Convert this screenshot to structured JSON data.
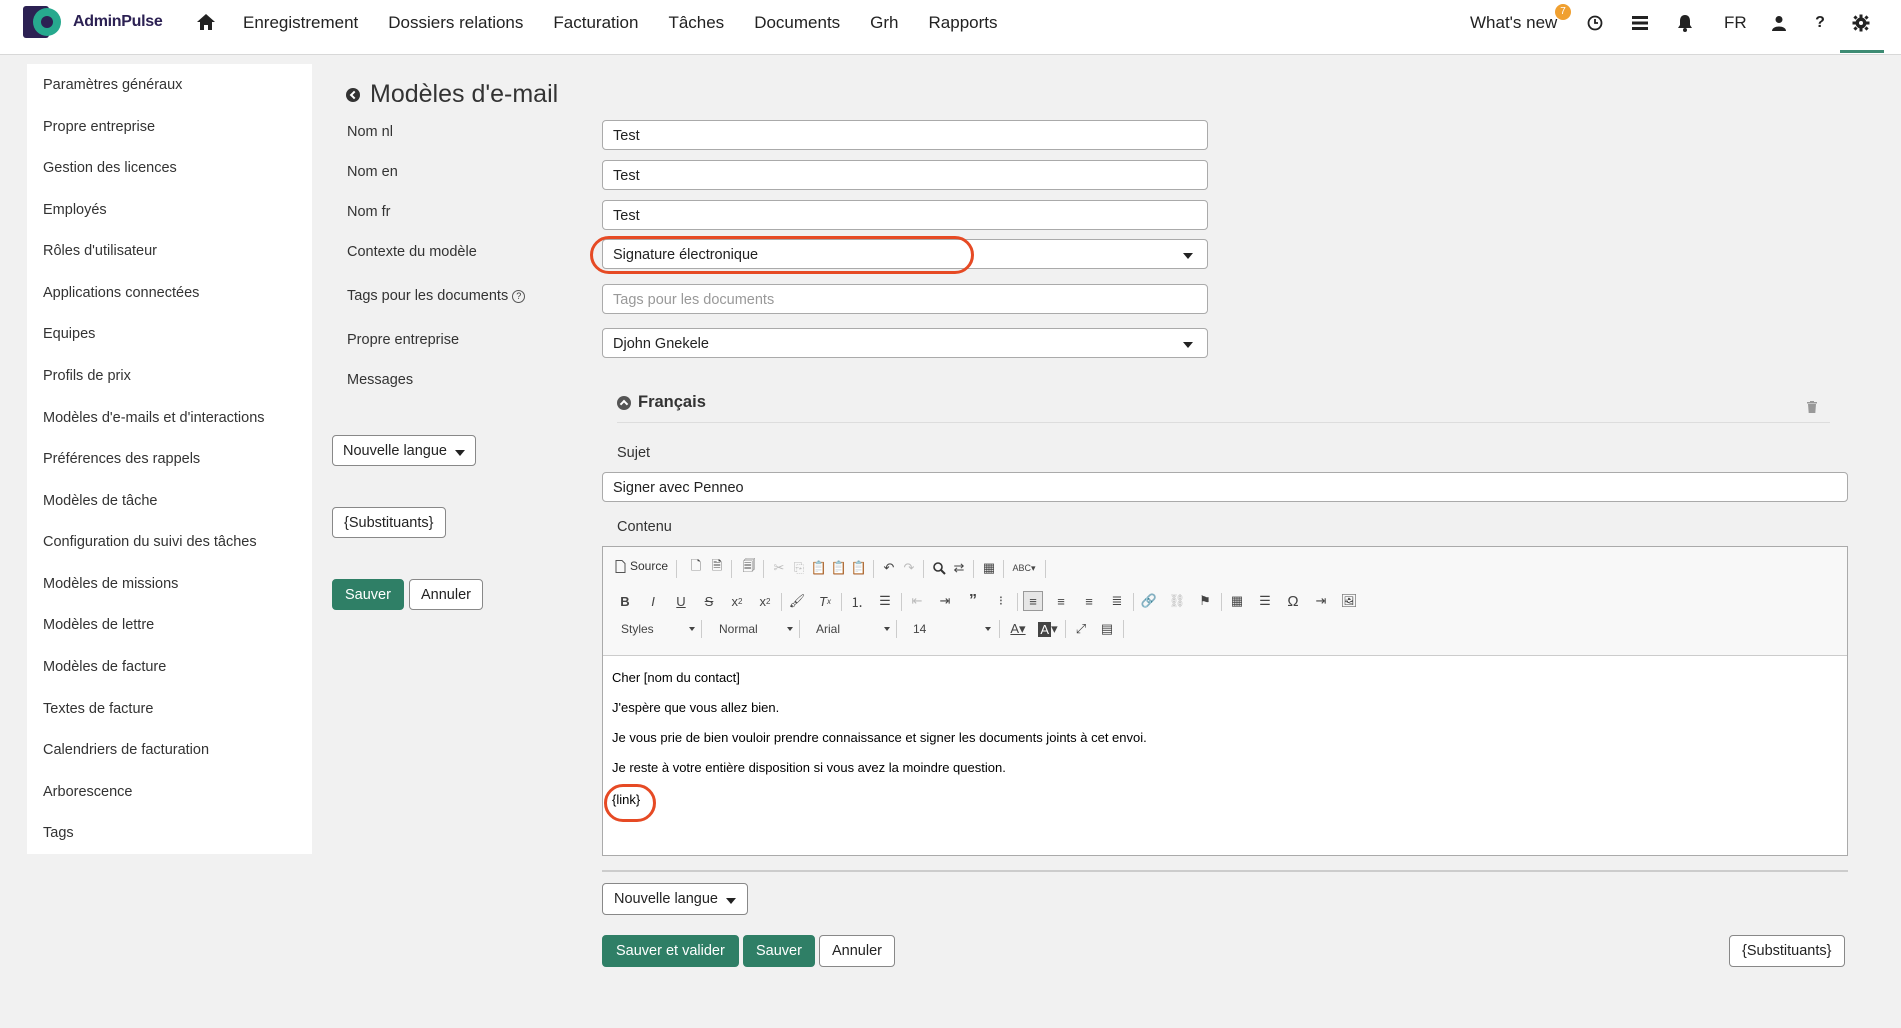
{
  "app": {
    "name": "AdminPulse"
  },
  "nav": {
    "items": [
      "Enregistrement",
      "Dossiers relations",
      "Facturation",
      "Tâches",
      "Documents",
      "Grh",
      "Rapports"
    ],
    "whats_new": "What's new",
    "whats_new_badge": "7",
    "language": "FR",
    "help": "?"
  },
  "sidebar": {
    "items": [
      "Paramètres généraux",
      "Propre entreprise",
      "Gestion des licences",
      "Employés",
      "Rôles d'utilisateur",
      "Applications connectées",
      "Equipes",
      "Profils de prix",
      "Modèles d'e-mails et d'interactions",
      "Préférences des rappels",
      "Modèles de tâche",
      "Configuration du suivi des tâches",
      "Modèles de missions",
      "Modèles de lettre",
      "Modèles de facture",
      "Textes de facture",
      "Calendriers de facturation",
      "Arborescence",
      "Tags"
    ]
  },
  "form": {
    "title": "Modèles d'e-mail",
    "labels": {
      "nom_nl": "Nom nl",
      "nom_en": "Nom en",
      "nom_fr": "Nom fr",
      "contexte": "Contexte du modèle",
      "tags": "Tags pour les documents",
      "entreprise": "Propre entreprise",
      "messages": "Messages"
    },
    "values": {
      "nom_nl": "Test",
      "nom_en": "Test",
      "nom_fr": "Test",
      "contexte": "Signature électronique",
      "tags_placeholder": "Tags pour les documents",
      "entreprise": "Djohn Gnekele"
    },
    "left_buttons": {
      "nouvelle_langue": "Nouvelle langue",
      "substituants": "{Substituants}",
      "sauver": "Sauver",
      "annuler": "Annuler"
    }
  },
  "message": {
    "language": "Français",
    "sujet_label": "Sujet",
    "sujet": "Signer avec Penneo",
    "contenu_label": "Contenu",
    "toolbar": {
      "source": "Source",
      "styles": "Styles",
      "format": "Normal",
      "font": "Arial",
      "size": "14",
      "bold": "B",
      "italic": "I",
      "underline": "U",
      "strike": "S",
      "omega": "Ω"
    },
    "body": [
      "Cher [nom du contact]",
      "J'espère que vous allez bien.",
      "Je vous prie de bien vouloir prendre connaissance et signer les documents joints à cet envoi.",
      "Je reste à votre entière disposition si vous avez la moindre question.",
      "{link}"
    ]
  },
  "bottom_buttons": {
    "nouvelle_langue": "Nouvelle langue",
    "sauver_valider": "Sauver et valider",
    "sauver": "Sauver",
    "annuler": "Annuler",
    "substituants": "{Substituants}"
  },
  "colors": {
    "primary": "#2f7f66",
    "highlight": "#e64a24",
    "brand": "#2c2153",
    "accent": "#27a98e"
  }
}
